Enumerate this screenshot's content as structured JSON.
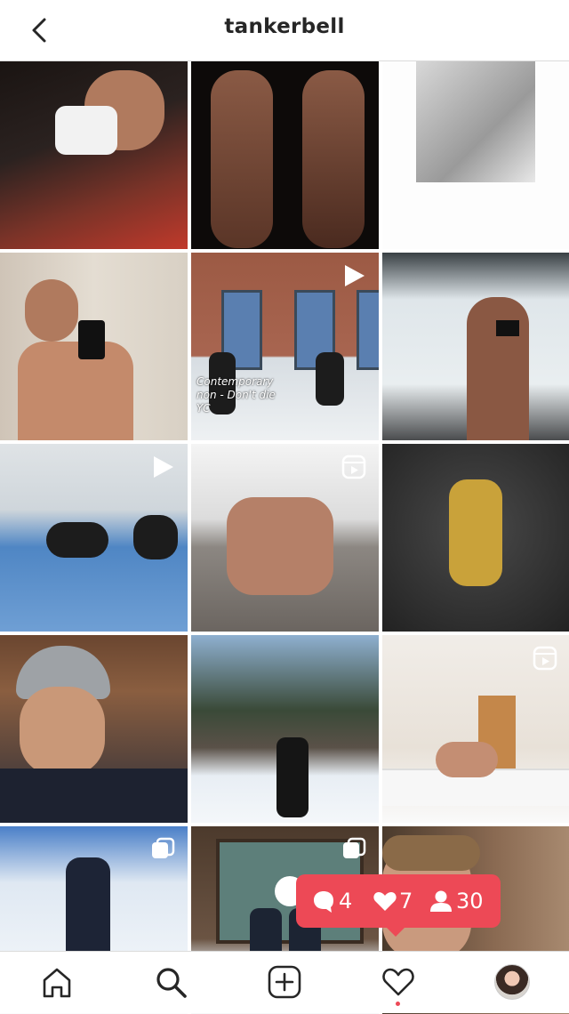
{
  "header": {
    "title": "tankerbell",
    "back_icon": "chevron-left-icon"
  },
  "grid": {
    "tiles": [
      {
        "name": "post-motocross",
        "badge": ""
      },
      {
        "name": "post-dancers-back",
        "badge": ""
      },
      {
        "name": "post-bw-torso",
        "badge": ""
      },
      {
        "name": "post-mirror-selfie",
        "badge": ""
      },
      {
        "name": "post-studio-dance",
        "badge": "video",
        "caption_line1": "Contemporary",
        "caption_line2": "non - Don't die",
        "caption_line3": "YC"
      },
      {
        "name": "post-window-selfie",
        "badge": ""
      },
      {
        "name": "post-rehearsal",
        "badge": "video"
      },
      {
        "name": "post-outdoor-partnering",
        "badge": "reel"
      },
      {
        "name": "post-gold-leap",
        "badge": ""
      },
      {
        "name": "post-beanie-selfie",
        "badge": ""
      },
      {
        "name": "post-snow-forest",
        "badge": ""
      },
      {
        "name": "post-bedroom-pose",
        "badge": "reel"
      },
      {
        "name": "post-ski-snow",
        "badge": "carousel"
      },
      {
        "name": "post-snowman",
        "badge": "carousel"
      },
      {
        "name": "post-closeup",
        "badge": ""
      }
    ]
  },
  "notification": {
    "comments": "4",
    "likes": "7",
    "follows": "30",
    "color": "#ed4956"
  },
  "tabbar": {
    "items": [
      "home-icon",
      "search-icon",
      "add-post-icon",
      "activity-heart-icon",
      "profile-avatar"
    ]
  }
}
